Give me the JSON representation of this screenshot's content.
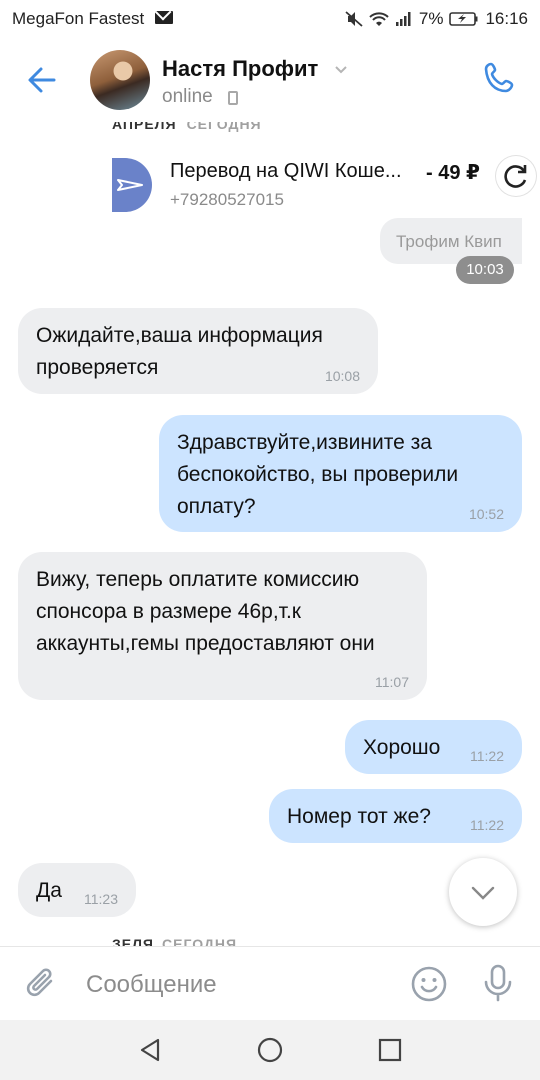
{
  "status_bar": {
    "carrier": "MegaFon Fastest",
    "battery": "7%",
    "time": "16:16"
  },
  "header": {
    "name": "Настя Профит",
    "presence": "online"
  },
  "top_date": {
    "month": "АПРЕЛЯ",
    "today": "СЕГОДНЯ"
  },
  "transfer": {
    "title": "Перевод на QIWI Коше...",
    "amount": "- 49 ₽",
    "phone": "+79280527015"
  },
  "quoted": {
    "text": "Трофим Квип",
    "time": "10:03"
  },
  "messages": [
    {
      "dir": "in",
      "text": "Ожидайте,ваша информация проверяется",
      "time": "10:08"
    },
    {
      "dir": "out",
      "text": "Здравствуйте,извините за беспокойство, вы проверили оплату?",
      "time": "10:52"
    },
    {
      "dir": "in",
      "text": "Вижу, теперь оплатите комиссию спонсора в размере 46р,т.к аккаунты,гемы предоставляют они",
      "time": "11:07"
    },
    {
      "dir": "out",
      "text": "Хорошо",
      "time": "11:22"
    },
    {
      "dir": "out",
      "text": "Номер тот же?",
      "time": "11:22"
    },
    {
      "dir": "in",
      "text": "Да",
      "time": "11:23"
    }
  ],
  "bottom_date": {
    "month": "ЗЕЛЯ",
    "today": "СЕГОДНЯ"
  },
  "composer": {
    "placeholder": "Сообщение"
  },
  "colors": {
    "accent": "#3f8ae0",
    "bubble_in": "#edeef0",
    "bubble_out": "#cce4ff"
  }
}
